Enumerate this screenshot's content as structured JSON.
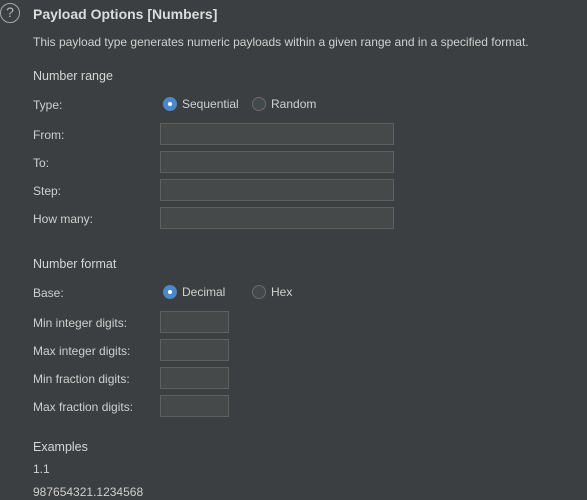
{
  "header": {
    "help_icon_glyph": "?",
    "title": "Payload Options [Numbers]",
    "description": "This payload type generates numeric payloads within a given range and in a specified format."
  },
  "number_range": {
    "heading": "Number range",
    "type_label": "Type:",
    "type_options": [
      {
        "label": "Sequential",
        "selected": true
      },
      {
        "label": "Random",
        "selected": false
      }
    ],
    "from_label": "From:",
    "from_value": "",
    "to_label": "To:",
    "to_value": "",
    "step_label": "Step:",
    "step_value": "",
    "how_many_label": "How many:",
    "how_many_value": ""
  },
  "number_format": {
    "heading": "Number format",
    "base_label": "Base:",
    "base_options": [
      {
        "label": "Decimal",
        "selected": true
      },
      {
        "label": "Hex",
        "selected": false
      }
    ],
    "min_integer_label": "Min integer digits:",
    "min_integer_value": "",
    "max_integer_label": "Max integer digits:",
    "max_integer_value": "",
    "min_fraction_label": "Min fraction digits:",
    "min_fraction_value": "",
    "max_fraction_label": "Max fraction digits:",
    "max_fraction_value": ""
  },
  "examples": {
    "heading": "Examples",
    "values": [
      "1.1",
      "987654321.1234568"
    ]
  },
  "colors": {
    "background": "#3c3f41",
    "field_background": "#45494a",
    "field_border": "#5e6060",
    "radio_selected": "#4a88c7"
  }
}
